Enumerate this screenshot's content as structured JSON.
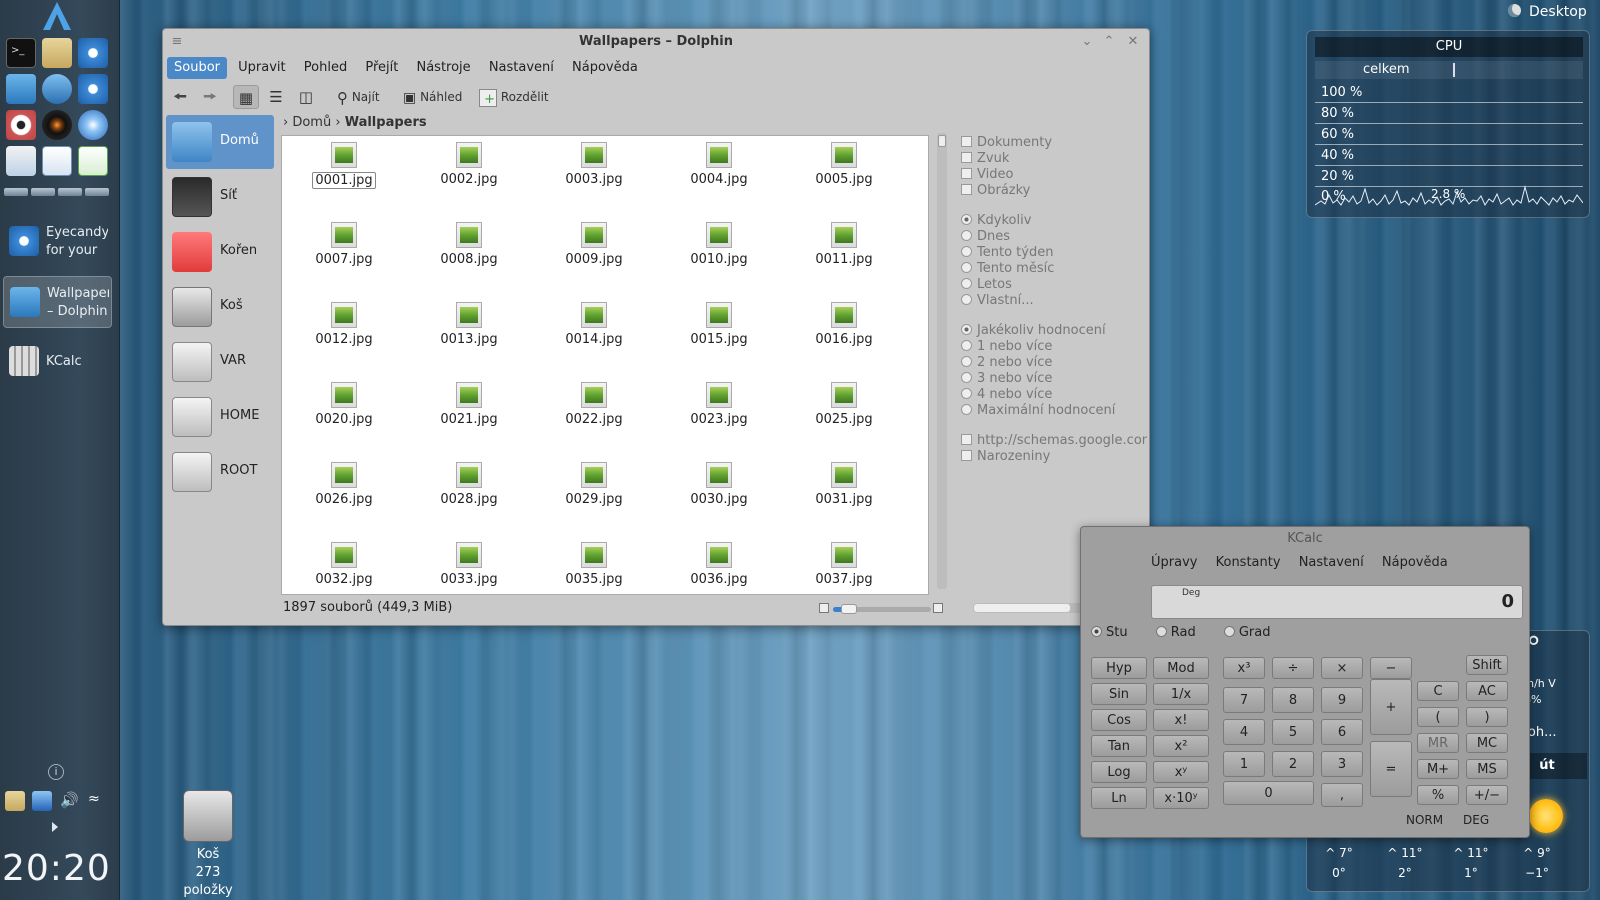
{
  "panel": {
    "tasks": [
      {
        "label": "Eyecandy for your KDE"
      },
      {
        "label": "Wallpapers – Dolphin"
      },
      {
        "label": "KCalc"
      }
    ],
    "clock": "20:20"
  },
  "desktop": {
    "toggle_label": "Desktop",
    "trash_label": "Koš",
    "trash_count": "273 položky"
  },
  "cpu": {
    "title": "CPU",
    "subtitle": "celkem",
    "rows": [
      "100 %",
      "80 %",
      "60 %",
      "40 %",
      "20 %",
      "0 %"
    ],
    "current": "2.8 %"
  },
  "weather": {
    "temp_big": "0°",
    "wind": "km/h V",
    "humidity": "86%",
    "city": "Boh...",
    "day": "út",
    "highs": [
      "^ 7°",
      "^ 11°",
      "^ 11°",
      "^ 9°"
    ],
    "lows": [
      "0°",
      "2°",
      "1°",
      "−1°"
    ]
  },
  "dolphin": {
    "title": "Wallpapers – Dolphin",
    "menu": [
      "Soubor",
      "Upravit",
      "Pohled",
      "Přejít",
      "Nástroje",
      "Nastavení",
      "Nápověda"
    ],
    "toolbar": {
      "find": "Najít",
      "preview": "Náhled",
      "split": "Rozdělit"
    },
    "places": [
      "Domů",
      "Síť",
      "Kořen",
      "Koš",
      "VAR",
      "HOME",
      "ROOT"
    ],
    "breadcrumb": [
      "Domů",
      "Wallpapers"
    ],
    "files": [
      "0001.jpg",
      "0002.jpg",
      "0003.jpg",
      "0004.jpg",
      "0005.jpg",
      "0007.jpg",
      "0008.jpg",
      "0009.jpg",
      "0010.jpg",
      "0011.jpg",
      "0012.jpg",
      "0013.jpg",
      "0014.jpg",
      "0015.jpg",
      "0016.jpg",
      "0020.jpg",
      "0021.jpg",
      "0022.jpg",
      "0023.jpg",
      "0025.jpg",
      "0026.jpg",
      "0028.jpg",
      "0029.jpg",
      "0030.jpg",
      "0031.jpg",
      "0032.jpg",
      "0033.jpg",
      "0035.jpg",
      "0036.jpg",
      "0037.jpg"
    ],
    "filter_types": [
      "Dokumenty",
      "Zvuk",
      "Video",
      "Obrázky"
    ],
    "filter_dates": [
      "Kdykoliv",
      "Dnes",
      "Tento týden",
      "Tento měsíc",
      "Letos",
      "Vlastní..."
    ],
    "filter_ratings": [
      "Jakékoliv hodnocení",
      "1 nebo více",
      "2 nebo více",
      "3 nebo více",
      "4 nebo více",
      "Maximální hodnocení"
    ],
    "filter_tags": [
      "http://schemas.google.com",
      "Narozeniny"
    ],
    "status": "1897 souborů (449,3 MiB)"
  },
  "kcalc": {
    "title": "KCalc",
    "menu": [
      "Úpravy",
      "Konstanty",
      "Nastavení",
      "Nápověda"
    ],
    "display_mode": "Deg",
    "display_value": "0",
    "angle": [
      "Stu",
      "Rad",
      "Grad"
    ],
    "func_buttons": [
      "Hyp",
      "Mod",
      "Sin",
      "1/x",
      "Cos",
      "x!",
      "Tan",
      "x²",
      "Log",
      "xʸ",
      "Ln",
      "x·10ʸ"
    ],
    "ops_top": [
      "x³",
      "÷",
      "×",
      "−"
    ],
    "digits": [
      "7",
      "8",
      "9",
      "4",
      "5",
      "6",
      "1",
      "2",
      "3"
    ],
    "zero": "0",
    "comma": ",",
    "plus": "+",
    "equals": "=",
    "right_buttons": [
      "Shift",
      "C",
      "AC",
      "(",
      ")",
      "MR",
      "MC",
      "M+",
      "MS",
      "%",
      "+/−"
    ],
    "status": [
      "NORM",
      "DEG"
    ]
  }
}
